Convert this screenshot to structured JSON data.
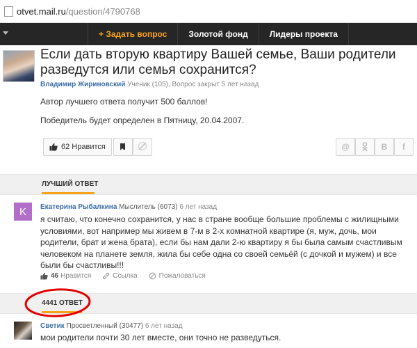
{
  "url": {
    "host": "otvet.mail.ru",
    "path": "/question/4790768"
  },
  "nav": {
    "ask_label": "+ Задать вопрос",
    "tabs": [
      "Золотой фонд",
      "Лидеры проекта"
    ]
  },
  "question": {
    "title": "Если дать вторую квартиру Вашей семье, Ваши родители разведутся или семья сохранится?",
    "author": "Владимир Жириновский",
    "meta": "Ученик (105), Вопрос закрыт 5 лет назад",
    "line1": "Автор лучшего ответа получит 500 баллов!",
    "line2": "Победитель будет определен в Пятницу, 20.04.2007.",
    "likes_label": "62 Нравится"
  },
  "share": {
    "mail": "@",
    "ok": "ok",
    "vk": "B",
    "fb": "f"
  },
  "best_answer": {
    "section_label": "ЛУЧШИЙ ОТВЕТ",
    "avatar_letter": "K",
    "author": "Екатерина Рыбалкина",
    "rank": "Мыслитель (6073)",
    "time": "6 лет назад",
    "text": "я считаю, что конечно сохранится, у нас в стране вообще большие проблемы с жилищными условиями, вот например мы живем в 7-м в 2-х комнатной квартире (я, муж, дочь, мои родители, брат и жена брата), если бы нам дали 2-ю квартиру я бы была самым счастливым человеком на планете земля, жила бы себе одна со своей семьёй (с дочкой и мужем) и все были бы счастливы!!!",
    "likes_count": "46",
    "likes_label": "Нравится",
    "link_label": "Ссылка",
    "report_label": "Пожаловаться"
  },
  "answers": {
    "section_label": "4441 ОТВЕТ",
    "items": [
      {
        "author": "Светик",
        "rank": "Просветленный (30477)",
        "time": "6 лет назад",
        "text": "мои родители почти 30 лет вместе, они точно не разведуться."
      }
    ]
  },
  "colors": {
    "accent": "#f8a21a",
    "link": "#3a6ca8",
    "navbar": "#262626",
    "annotation": "#e00000",
    "avatar_k": "#b26ec9"
  }
}
